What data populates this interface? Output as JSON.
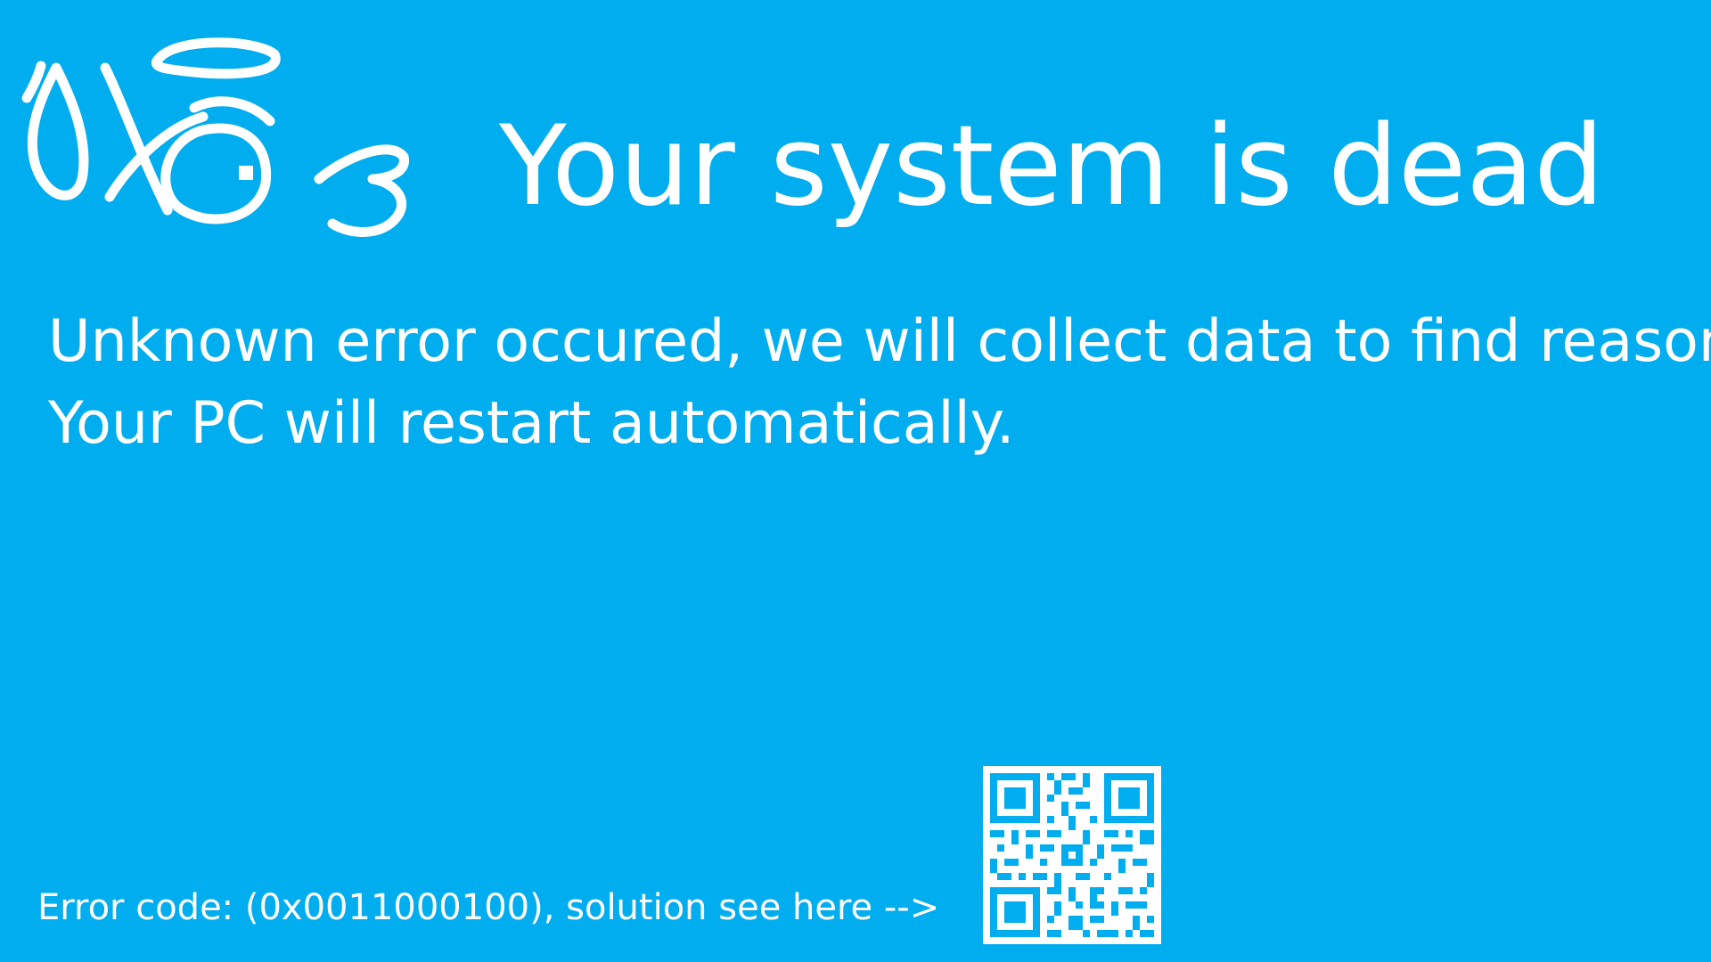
{
  "screen": {
    "background_color": "#00adef",
    "text_color": "#ffffff",
    "face_icon": "sad-face-doodle-icon",
    "title": "Your system is dead",
    "message_lines": [
      "Unknown error occured, we will collect data to find reason.",
      "Your PC will restart automatically."
    ],
    "error_text": "Error code: (0x0011000100), solution see here -->",
    "qr_icon": "qr-code-icon"
  }
}
